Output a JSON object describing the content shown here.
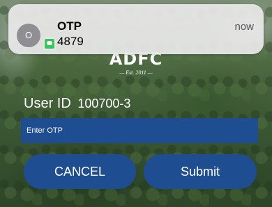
{
  "notification": {
    "avatar_initial": "O",
    "app_icon": "messages-icon",
    "title": "OTP",
    "body": "4879",
    "time": "now"
  },
  "logo": {
    "text": "ADFC",
    "est": "— Est. 2011 —"
  },
  "form": {
    "user_id_label": "User ID",
    "user_id_value": "100700-3",
    "otp_placeholder": "Enter OTP",
    "cancel_label": "CANCEL",
    "submit_label": "Submit"
  },
  "colors": {
    "button_bg": "#1f4d91",
    "text": "#ffffff",
    "notification_bg": "#e8e8e8",
    "messages_green": "#34c759"
  }
}
